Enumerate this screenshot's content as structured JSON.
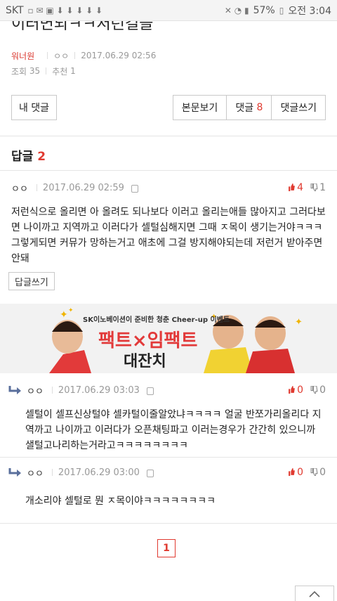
{
  "statusbar": {
    "carrier": "SKT",
    "battery": "57%",
    "clock": "오전 3:04"
  },
  "post": {
    "title_cut": "이러면되ㅋㅋ저런걸들",
    "author": "워너원",
    "nick": "ㅇㅇ",
    "date": "2017.06.29 02:56",
    "views_label": "조회",
    "views": "35",
    "likes_label": "추천",
    "likes": "1"
  },
  "actions": {
    "my_comments": "내 댓글",
    "view_body": "본문보기",
    "comments_label": "댓글",
    "comments_count": "8",
    "write_comment": "댓글쓰기"
  },
  "reply_section": {
    "label": "답글",
    "count": "2"
  },
  "comments": [
    {
      "nick": "ㅇㅇ",
      "date": "2017.06.29 02:59",
      "up": "4",
      "down": "1",
      "body": "저런식으로 올리면 아 올려도 되나보다 이러고 올리는애들 많아지고 그러다보면 나이까고 지역까고 이러다가 셀털심해지면 그때 ㅈ목이 생기는거야ㅋㅋㅋ 그렇게되면 커뮤가 망하는거고 애초에 그걸 방지해야되는데 저런거 받아주면 안돼",
      "reply_label": "답글쓰기"
    },
    {
      "nick": "ㅇㅇ",
      "date": "2017.06.29 03:03",
      "up": "0",
      "down": "0",
      "body": "셀털이 셀프신상털야 셀카털이줄알았냐ㅋㅋㅋㅋ 얼굴 반쪼가리올리다 지역까고 나이까고 이러다가 오픈채팅파고 이러는경우가 간간히 있으니까 샐털고나리하는거라고ㅋㅋㅋㅋㅋㅋㅋㅋ"
    },
    {
      "nick": "ㅇㅇ",
      "date": "2017.06.29 03:00",
      "up": "0",
      "down": "0",
      "body": "개소리야 셀털로 뭔 ㅈ목이야ㅋㅋㅋㅋㅋㅋㅋㅋ"
    }
  ],
  "ad": {
    "sub": "SK이노베이션이 준비한 청춘 Cheer-up 이벤트",
    "main": "팩트×임팩트",
    "main2": "대잔치"
  },
  "pagination": {
    "current": "1"
  }
}
